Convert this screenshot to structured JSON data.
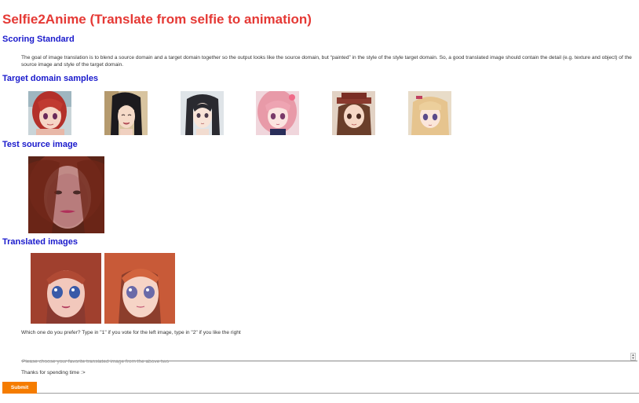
{
  "page": {
    "title": "Selfie2Anime (Translate from selfie to animation)",
    "accent_color": "#e53935",
    "heading_color": "#1a1acc",
    "button_color": "#f57c00"
  },
  "sections": {
    "scoring": {
      "heading": "Scoring Standard",
      "text": "The goal of image translation is to blend a source domain and a target domain together so the output looks like the source domain, but “painted” in the style of the style target domain. So, a good translated image should contain the detail (e.g. texture and object) of the source image and style of the target domain."
    },
    "target": {
      "heading": "Target domain samples",
      "samples": [
        "anime-girl-red-hair",
        "anime-girl-black-hair-smiling",
        "anime-girl-black-hair",
        "anime-girl-pink-hair",
        "anime-girl-brown-hair-hat",
        "anime-girl-blonde-hair"
      ]
    },
    "test": {
      "heading": "Test source image",
      "image": "selfie-woman-red-hair"
    },
    "translated": {
      "heading": "Translated images",
      "images": [
        "translated-anime-left",
        "translated-anime-right"
      ]
    }
  },
  "form": {
    "question": "Which one do you prefer? Type in \"1\" if you vote for the left image, type in \"2\" if you like the right",
    "input_placeholder": "Please choose your favorite translated image from the above two",
    "input_value": "",
    "thanks": "Thanks for spending time :>",
    "submit_label": "Submit"
  }
}
